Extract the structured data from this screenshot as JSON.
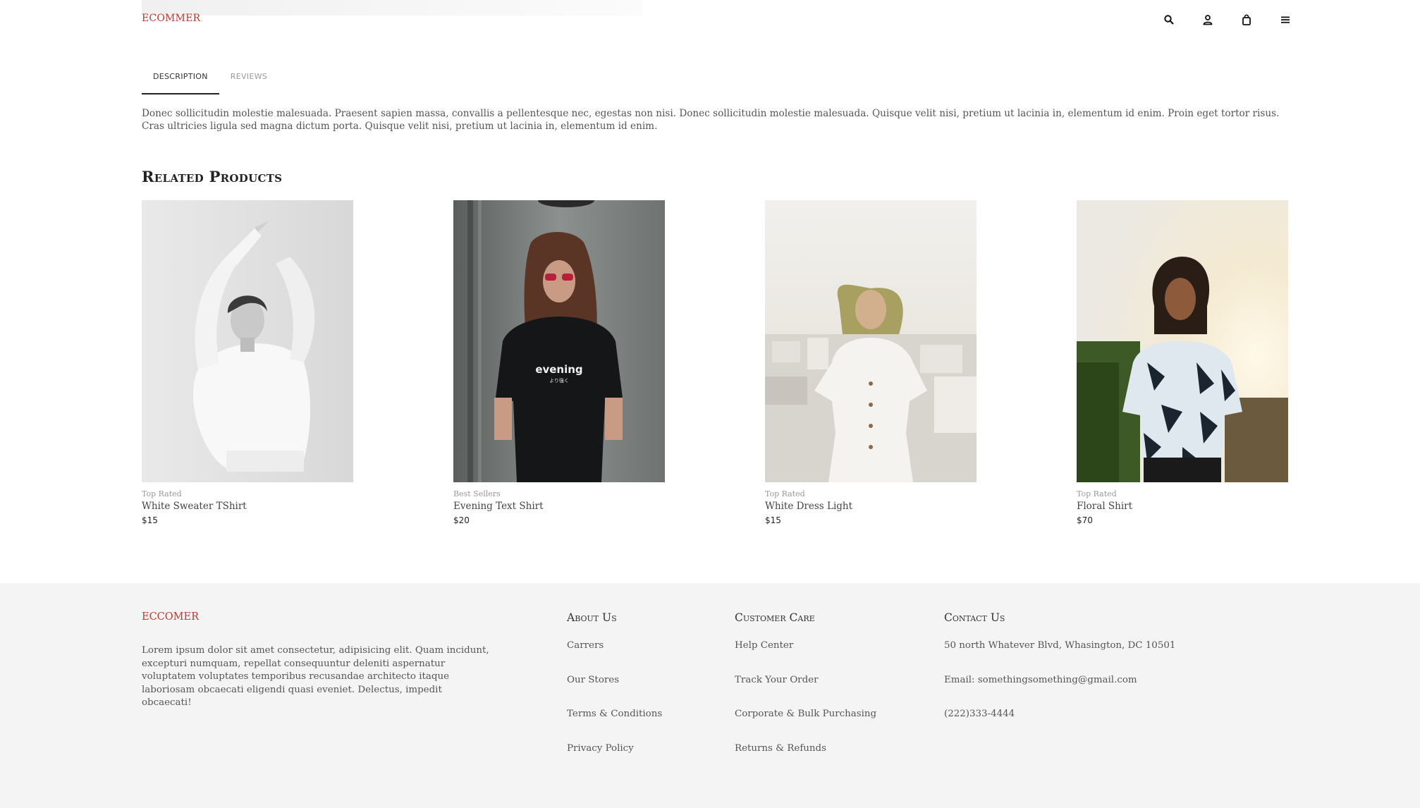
{
  "header": {
    "logo": "ECOMMER",
    "icons": [
      "search-icon",
      "user-icon",
      "bag-icon",
      "menu-icon"
    ]
  },
  "tabs": [
    {
      "label": "DESCRIPTION",
      "active": true
    },
    {
      "label": "REVIEWS",
      "active": false
    }
  ],
  "description": "Donec sollicitudin molestie malesuada. Praesent sapien massa, convallis a pellentesque nec, egestas non nisi. Donec sollicitudin molestie malesuada. Quisque velit nisi, pretium ut lacinia in, elementum id enim. Proin eget tortor risus. Cras ultricies ligula sed magna dictum porta. Quisque velit nisi, pretium ut lacinia in, elementum id enim.",
  "related": {
    "title": "Related Products",
    "products": [
      {
        "category": "Top Rated",
        "name": "White Sweater TShirt",
        "price": "$15"
      },
      {
        "category": "Best Sellers",
        "name": "Evening Text Shirt",
        "price": "$20",
        "shirt_text": "evening",
        "shirt_subtext": "より強く"
      },
      {
        "category": "Top Rated",
        "name": "White Dress Light",
        "price": "$15"
      },
      {
        "category": "Top Rated",
        "name": "Floral Shirt",
        "price": "$70"
      }
    ]
  },
  "footer": {
    "brand": "ECCOMER",
    "about_text": "Lorem ipsum dolor sit amet consectetur, adipisicing elit. Quam incidunt, excepturi numquam, repellat consequuntur deleniti aspernatur voluptatem voluptates temporibus recusandae architecto itaque laboriosam obcaecati eligendi quasi eveniet. Delectus, impedit obcaecati!",
    "about_us": {
      "title": "About Us",
      "links": [
        "Carrers",
        "Our Stores",
        "Terms & Conditions",
        "Privacy Policy"
      ]
    },
    "customer_care": {
      "title": "Customer Care",
      "links": [
        "Help Center",
        "Track Your Order",
        "Corporate & Bulk Purchasing",
        "Returns & Refunds"
      ]
    },
    "contact": {
      "title": "Contact Us",
      "lines": [
        "50 north Whatever Blvd, Whasington, DC 10501",
        "Email: somethingsomething@gmail.com",
        "(222)333-4444"
      ]
    }
  },
  "colors": {
    "brand": "#c0392b",
    "footer_bg": "#f4f4f4"
  }
}
